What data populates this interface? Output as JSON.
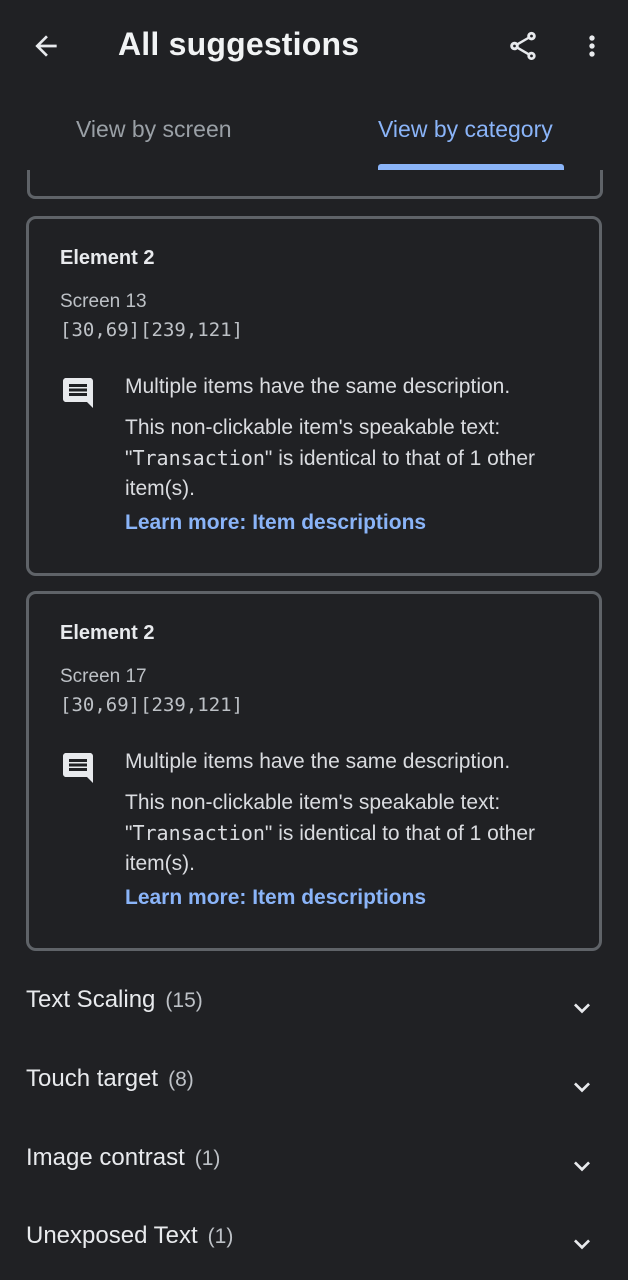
{
  "appbar": {
    "title": "All suggestions",
    "back_icon": "arrow-back-icon",
    "share_icon": "share-icon",
    "more_icon": "more-vert-icon"
  },
  "tabs": [
    {
      "label": "View by screen",
      "active": false
    },
    {
      "label": "View by category",
      "active": true
    }
  ],
  "cards": [
    {
      "element_title": "Element 2",
      "screen": "Screen 13",
      "bounds": "[30,69][239,121]",
      "issue_title": "Multiple items have the same description.",
      "desc_prefix": "This non-clickable item's speakable text: \"",
      "desc_code": "Transaction",
      "desc_suffix": "\" is identical to that of 1 other item(s).",
      "link": "Learn more: Item descriptions"
    },
    {
      "element_title": "Element 2",
      "screen": "Screen 17",
      "bounds": "[30,69][239,121]",
      "issue_title": "Multiple items have the same description.",
      "desc_prefix": "This non-clickable item's speakable text: \"",
      "desc_code": "Transaction",
      "desc_suffix": "\" is identical to that of 1 other item(s).",
      "link": "Learn more: Item descriptions"
    }
  ],
  "categories": [
    {
      "name": "Text Scaling",
      "count": "(15)"
    },
    {
      "name": "Touch target",
      "count": "(8)"
    },
    {
      "name": "Image contrast",
      "count": "(1)"
    },
    {
      "name": "Unexposed Text",
      "count": "(1)"
    }
  ],
  "colors": {
    "background": "#202124",
    "accent": "#8ab4f8",
    "card_border": "#5f6368"
  }
}
